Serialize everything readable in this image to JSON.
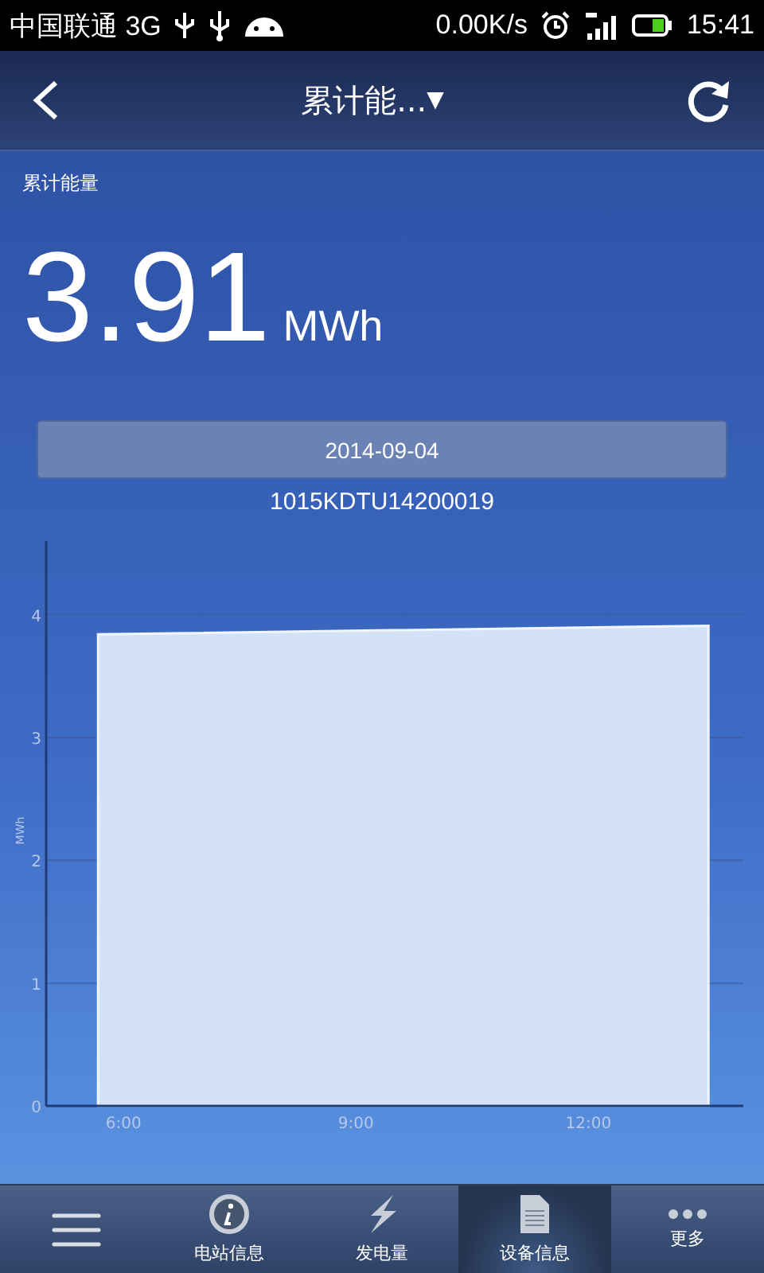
{
  "status_bar": {
    "carrier": "中国联通 3G",
    "speed": "0.00K/s",
    "time": "15:41"
  },
  "header": {
    "title": "累计能...",
    "dropdown": "▼"
  },
  "summary": {
    "label": "累计能量",
    "value": "3.91",
    "unit": "MWh"
  },
  "date_button": "2014-09-04",
  "device_id": "1015KDTU14200019",
  "chart": {
    "chart_data": {
      "type": "area",
      "ylabel": "MWh",
      "x": [
        5.67,
        13.55
      ],
      "grid": true,
      "series": [
        {
          "color": "#d4e2f7",
          "values": [
            3.84,
            3.91
          ]
        }
      ],
      "xlim": [
        5,
        14
      ],
      "ylim": [
        0,
        4.6
      ],
      "xticks": [
        {
          "value": 6,
          "label": "6:00"
        },
        {
          "value": 9,
          "label": "9:00"
        },
        {
          "value": 12,
          "label": "12:00"
        }
      ],
      "yticks": [
        0,
        1,
        2,
        3,
        4
      ]
    }
  },
  "tabs": [
    {
      "kind": "menu",
      "selected": false
    },
    {
      "kind": "info",
      "label": "电站信息",
      "selected": false
    },
    {
      "kind": "bolt",
      "label": "发电量",
      "selected": false
    },
    {
      "kind": "doc",
      "label": "设备信息",
      "selected": true
    },
    {
      "kind": "more",
      "label": "更多",
      "selected": false
    }
  ]
}
